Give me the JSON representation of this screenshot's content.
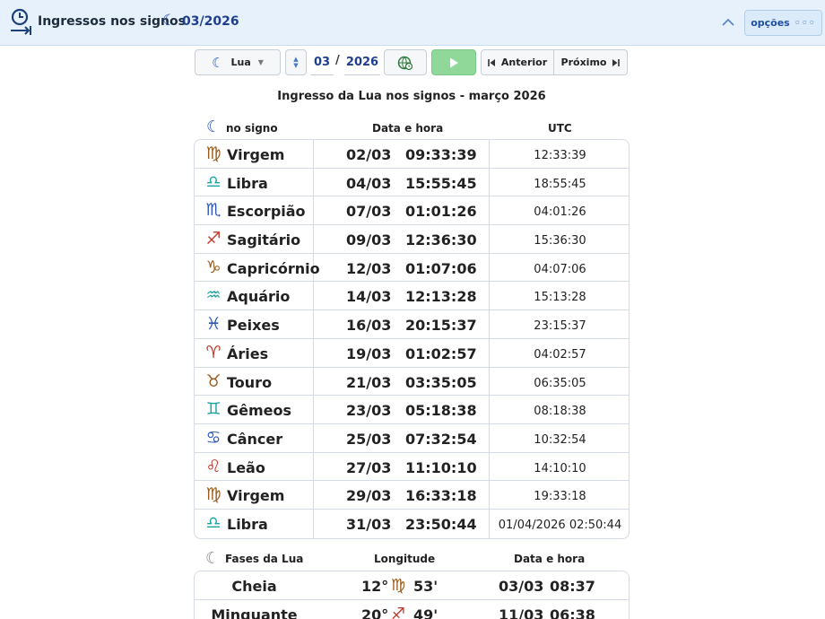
{
  "header": {
    "title": "Ingressos nos signos",
    "moon_glyph": "☾",
    "date": "03/2026",
    "options_label": "opções",
    "options_dots": "◦◦◦"
  },
  "toolbar": {
    "body_glyph": "☾",
    "body_label": "Lua",
    "month": "03",
    "separator": "/",
    "year": "2026",
    "prev_label": "Anterior",
    "next_label": "Próximo"
  },
  "table": {
    "title": "Ingresso da Lua nos signos - março 2026",
    "header_moon_glyph": "☾",
    "col_sign": "no signo",
    "col_datetime": "Data e hora",
    "col_utc": "UTC",
    "rows": [
      {
        "glyph": "♍",
        "color": "#9a5b1c",
        "sign": "Virgem",
        "date": "02/03",
        "time": "09:33:39",
        "utc": "12:33:39"
      },
      {
        "glyph": "♎",
        "color": "#1ba3a3",
        "sign": "Libra",
        "date": "04/03",
        "time": "15:55:45",
        "utc": "18:55:45"
      },
      {
        "glyph": "♏",
        "color": "#2a56b8",
        "sign": "Escorpião",
        "date": "07/03",
        "time": "01:01:26",
        "utc": "04:01:26"
      },
      {
        "glyph": "♐",
        "color": "#c0392b",
        "sign": "Sagitário",
        "date": "09/03",
        "time": "12:36:30",
        "utc": "15:36:30"
      },
      {
        "glyph": "♑",
        "color": "#9a5b1c",
        "sign": "Capricórnio",
        "date": "12/03",
        "time": "01:07:06",
        "utc": "04:07:06"
      },
      {
        "glyph": "♒",
        "color": "#1ba3a3",
        "sign": "Aquário",
        "date": "14/03",
        "time": "12:13:28",
        "utc": "15:13:28"
      },
      {
        "glyph": "♓",
        "color": "#2a56b8",
        "sign": "Peixes",
        "date": "16/03",
        "time": "20:15:37",
        "utc": "23:15:37"
      },
      {
        "glyph": "♈",
        "color": "#c0392b",
        "sign": "Áries",
        "date": "19/03",
        "time": "01:02:57",
        "utc": "04:02:57"
      },
      {
        "glyph": "♉",
        "color": "#9a5b1c",
        "sign": "Touro",
        "date": "21/03",
        "time": "03:35:05",
        "utc": "06:35:05"
      },
      {
        "glyph": "♊",
        "color": "#1ba3a3",
        "sign": "Gêmeos",
        "date": "23/03",
        "time": "05:18:38",
        "utc": "08:18:38"
      },
      {
        "glyph": "♋",
        "color": "#2a56b8",
        "sign": "Câncer",
        "date": "25/03",
        "time": "07:32:54",
        "utc": "10:32:54"
      },
      {
        "glyph": "♌",
        "color": "#c0392b",
        "sign": "Leão",
        "date": "27/03",
        "time": "11:10:10",
        "utc": "14:10:10"
      },
      {
        "glyph": "♍",
        "color": "#9a5b1c",
        "sign": "Virgem",
        "date": "29/03",
        "time": "16:33:18",
        "utc": "19:33:18"
      },
      {
        "glyph": "♎",
        "color": "#1ba3a3",
        "sign": "Libra",
        "date": "31/03",
        "time": "23:50:44",
        "utc": "01/04/2026 02:50:44"
      }
    ]
  },
  "phases": {
    "header_glyph": "☾",
    "col_phase": "Fases da Lua",
    "col_longitude": "Longitude",
    "col_datetime": "Data e hora",
    "rows": [
      {
        "name": "Cheia",
        "degree": "12°",
        "glyph": "♍",
        "color": "#9a5b1c",
        "minutes": "53'",
        "date": "03/03",
        "time": "08:37"
      },
      {
        "name": "Minguante",
        "degree": "20°",
        "glyph": "♐",
        "color": "#c0392b",
        "minutes": "49'",
        "date": "11/03",
        "time": "06:38"
      }
    ]
  }
}
